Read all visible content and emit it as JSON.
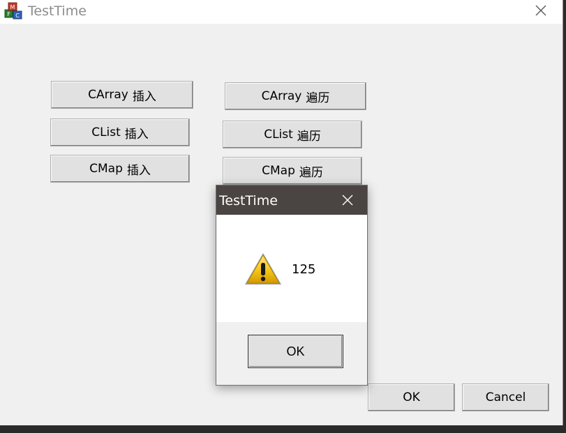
{
  "window": {
    "title": "TestTime",
    "icon": "mfc-app-icon",
    "close_icon": "close-icon"
  },
  "buttons": {
    "carray_insert": {
      "lat": "CArray",
      "cjk": "插入"
    },
    "clist_insert": {
      "lat": "CList",
      "cjk": "插入"
    },
    "cmap_insert": {
      "lat": "CMap",
      "cjk": "插入"
    },
    "carray_traverse": {
      "lat": "CArray",
      "cjk": "遍历"
    },
    "clist_traverse": {
      "lat": "CList",
      "cjk": "遍历"
    },
    "cmap_traverse": {
      "lat": "CMap",
      "cjk": "遍历"
    },
    "ok": "OK",
    "cancel": "Cancel"
  },
  "message_box": {
    "title": "TestTime",
    "icon": "warning-icon",
    "message": "125",
    "ok_label": "OK",
    "titlebar_color": "#4a4542"
  }
}
